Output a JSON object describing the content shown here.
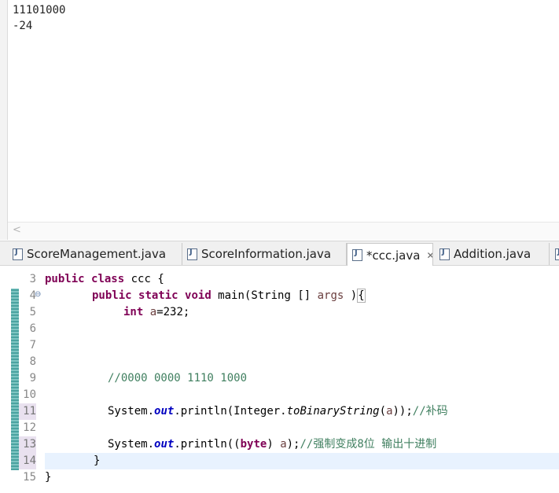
{
  "console": {
    "lines": [
      "11101000",
      "-24"
    ]
  },
  "tabs": [
    {
      "label": "ScoreManagement.java",
      "active": false
    },
    {
      "label": "ScoreInformation.java",
      "active": false
    },
    {
      "label": "*ccc.java",
      "active": true,
      "close": "✕"
    },
    {
      "label": "Addition.java",
      "active": false
    }
  ],
  "editor": {
    "line_numbers": [
      "3",
      "4",
      "5",
      "6",
      "7",
      "8",
      "9",
      "10",
      "11",
      "12",
      "13",
      "14",
      "15"
    ],
    "code": {
      "l3_kw1": "public",
      "l3_kw2": "class",
      "l3_rest": " ccc {",
      "l4_kw1": "public",
      "l4_kw2": "static",
      "l4_kw3": "void",
      "l4_rest1": " main(String [] ",
      "l4_var": "args",
      "l4_rest2": " )",
      "l4_brace": "{",
      "l5_kw": "int",
      "l5_var": "a",
      "l5_rest": "=232;",
      "l9_comment": "//0000 0000 1110 1000",
      "l11_a": "System.",
      "l11_field": "out",
      "l11_b": ".println(Integer.",
      "l11_method": "toBinaryString",
      "l11_c": "(",
      "l11_var": "a",
      "l11_d": "));",
      "l11_comment": "//补码",
      "l13_a": "System.",
      "l13_field": "out",
      "l13_b": ".println((",
      "l13_kw": "byte",
      "l13_c": ") ",
      "l13_var": "a",
      "l13_d": ");",
      "l13_comment": "//强制变成8位 输出十进制",
      "l14": "}",
      "l15": "}"
    }
  }
}
